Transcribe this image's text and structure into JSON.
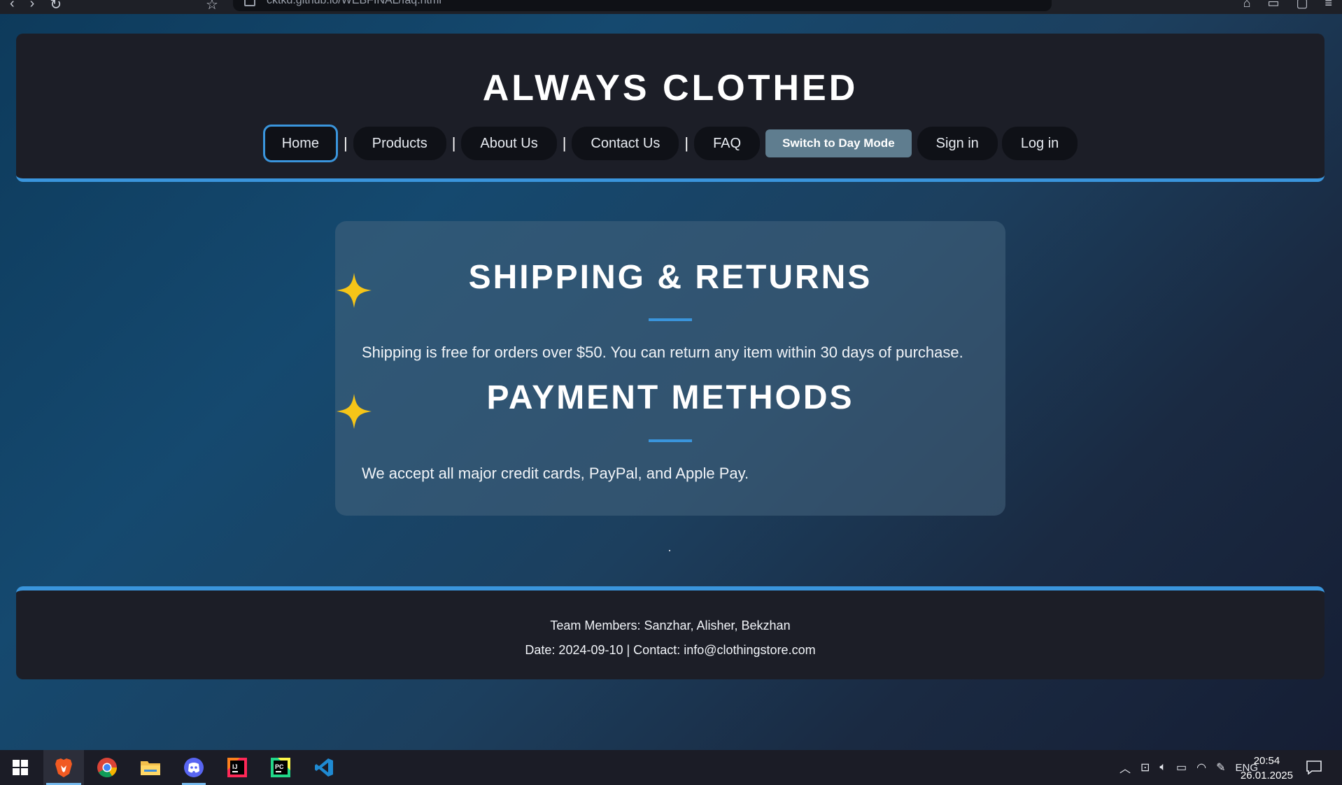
{
  "browser": {
    "url": "cktkd.github.io/WEBFINAL/faq.html"
  },
  "header": {
    "title": "ALWAYS CLOTHED",
    "nav": [
      {
        "label": "Home"
      },
      {
        "label": "Products"
      },
      {
        "label": "About Us"
      },
      {
        "label": "Contact Us"
      },
      {
        "label": "FAQ"
      }
    ],
    "separator": "|",
    "mode_button": "Switch to Day Mode",
    "sign_in": "Sign in",
    "log_in": "Log in"
  },
  "sections": [
    {
      "title": "SHIPPING & RETURNS",
      "text": "Shipping is free for orders over $50. You can return any item within 30 days of purchase."
    },
    {
      "title": "PAYMENT METHODS",
      "text": "We accept all major credit cards, PayPal, and Apple Pay."
    }
  ],
  "footer": {
    "team": "Team Members: Sanzhar, Alisher, Bekzhan",
    "date_contact": "Date: 2024-09-10 | Contact: info@clothingstore.com"
  },
  "taskbar": {
    "apps": [
      "windows-start",
      "brave",
      "chrome",
      "file-explorer",
      "discord",
      "intellij-idea",
      "pycharm",
      "vscode"
    ],
    "language": "ENG",
    "time": "20:54",
    "date": "26.01.2025"
  },
  "colors": {
    "accent": "#3a95dc",
    "header_bg": "#1c1e27",
    "sparkle": "#f5c518",
    "mode_button": "#5f7d8f"
  }
}
